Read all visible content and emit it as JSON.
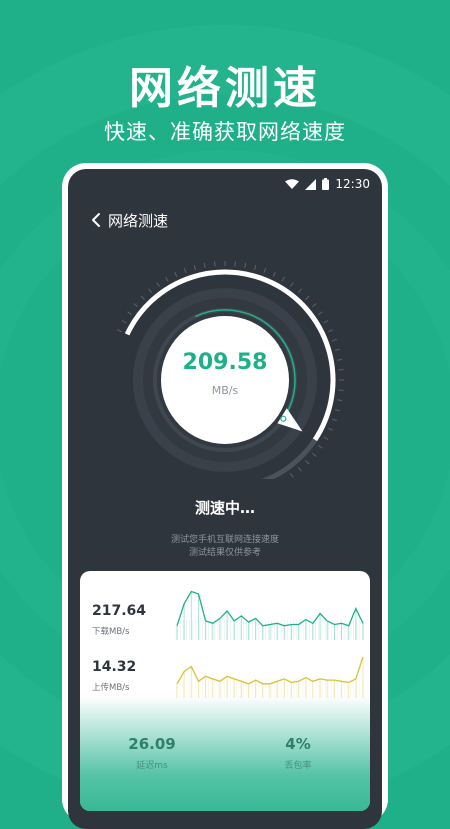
{
  "promo": {
    "title": "网络测速",
    "subtitle": "快速、准确获取网络速度"
  },
  "status_bar": {
    "time": "12:30",
    "icons": [
      "wifi-icon",
      "signal-icon",
      "battery-icon"
    ]
  },
  "nav": {
    "title": "网络测速"
  },
  "gauge": {
    "speed_value": "209.58",
    "speed_unit": "MB/s",
    "progress": 0.82
  },
  "test": {
    "status": "测速中…",
    "desc_line1": "测试您手机互联网连接速度",
    "desc_line2": "测试结果仅供参考"
  },
  "results": {
    "download": {
      "value": "217.64",
      "label": "下载MB/s"
    },
    "upload": {
      "value": "14.32",
      "label": "上传MB/s"
    },
    "latency": {
      "value": "26.09",
      "label": "延迟ms"
    },
    "packet_loss": {
      "value": "4%",
      "label": "丢包率"
    }
  },
  "chart_data": [
    {
      "type": "area",
      "name": "download",
      "values": [
        10,
        28,
        38,
        36,
        14,
        12,
        16,
        22,
        14,
        18,
        13,
        16,
        10,
        11,
        12,
        10,
        11,
        11,
        15,
        12,
        20,
        14,
        11,
        12,
        10,
        24,
        12
      ],
      "color": "#1fb08a"
    },
    {
      "type": "area",
      "name": "upload",
      "values": [
        10,
        20,
        24,
        12,
        16,
        14,
        12,
        16,
        14,
        12,
        10,
        13,
        10,
        10,
        12,
        14,
        11,
        12,
        15,
        12,
        14,
        13,
        13,
        12,
        11,
        14,
        32
      ],
      "color": "#d6c23a"
    }
  ],
  "colors": {
    "accent": "#1fb08a",
    "screen_bg": "#2f353d",
    "upload": "#d6c23a"
  }
}
